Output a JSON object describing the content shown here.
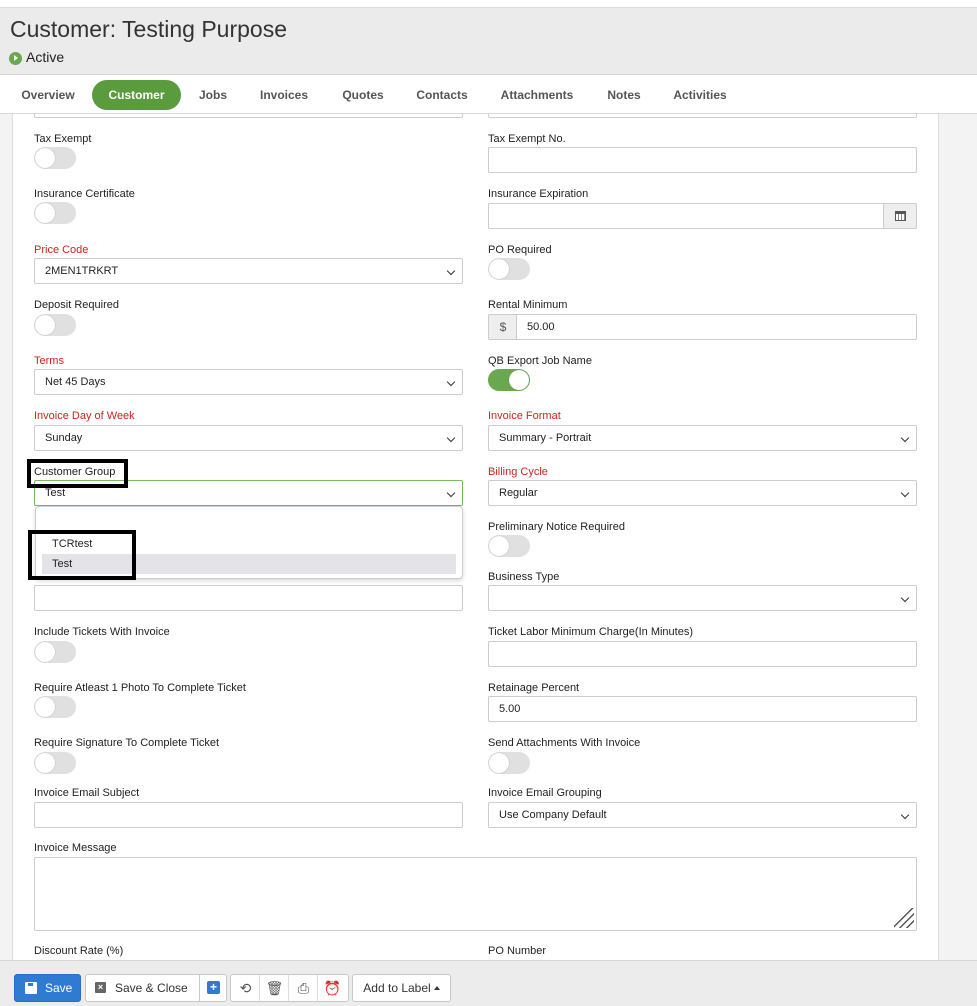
{
  "header": {
    "title": "Customer: Testing Purpose",
    "status": "Active"
  },
  "tabs": [
    {
      "label": "Overview"
    },
    {
      "label": "Customer",
      "active": true
    },
    {
      "label": "Jobs"
    },
    {
      "label": "Invoices"
    },
    {
      "label": "Quotes"
    },
    {
      "label": "Contacts"
    },
    {
      "label": "Attachments"
    },
    {
      "label": "Notes"
    },
    {
      "label": "Activities"
    }
  ],
  "form": {
    "tax_exempt": {
      "label": "Tax Exempt",
      "on": false
    },
    "tax_exempt_no": {
      "label": "Tax Exempt No.",
      "value": ""
    },
    "insurance_certificate": {
      "label": "Insurance Certificate",
      "on": false
    },
    "insurance_expiration": {
      "label": "Insurance Expiration",
      "value": ""
    },
    "price_code": {
      "label": "Price Code",
      "value": "2MEN1TRKRT"
    },
    "po_required": {
      "label": "PO Required",
      "on": false
    },
    "deposit_required": {
      "label": "Deposit Required",
      "on": false
    },
    "rental_minimum": {
      "label": "Rental Minimum",
      "prefix": "$",
      "value": "50.00"
    },
    "terms": {
      "label": "Terms",
      "value": "Net 45 Days"
    },
    "qb_export_job_name": {
      "label": "QB Export Job Name",
      "on": true
    },
    "invoice_day_of_week": {
      "label": "Invoice Day of Week",
      "value": "Sunday"
    },
    "invoice_format": {
      "label": "Invoice Format",
      "value": "Summary - Portrait"
    },
    "customer_group": {
      "label": "Customer Group",
      "value": "Test",
      "options": [
        "TCRtest",
        "Test"
      ]
    },
    "billing_cycle": {
      "label": "Billing Cycle",
      "value": "Regular"
    },
    "preliminary_notice_required": {
      "label": "Preliminary Notice Required",
      "on": false
    },
    "business_type": {
      "label": "Business Type",
      "value": ""
    },
    "include_tickets_with_invoice": {
      "label": "Include Tickets With Invoice",
      "on": false
    },
    "ticket_labor_minimum": {
      "label": "Ticket Labor Minimum Charge(In Minutes)",
      "value": ""
    },
    "require_photo": {
      "label": "Require Atleast 1 Photo To Complete Ticket",
      "on": false
    },
    "retainage_percent": {
      "label": "Retainage Percent",
      "value": "5.00"
    },
    "require_signature": {
      "label": "Require Signature To Complete Ticket",
      "on": false
    },
    "send_attachments": {
      "label": "Send Attachments With Invoice",
      "on": false
    },
    "invoice_email_subject": {
      "label": "Invoice Email Subject",
      "value": ""
    },
    "invoice_email_grouping": {
      "label": "Invoice Email Grouping",
      "value": "Use Company Default"
    },
    "invoice_message": {
      "label": "Invoice Message",
      "value": ""
    },
    "discount_rate": {
      "label": "Discount Rate (%)"
    },
    "po_number": {
      "label": "PO Number"
    }
  },
  "footer": {
    "save": "Save",
    "save_close": "Save & Close",
    "add_to_label": "Add to Label"
  },
  "colors": {
    "accent_green": "#5a9b3e",
    "required_red": "#c8261c",
    "primary_blue": "#2f7bd1"
  }
}
